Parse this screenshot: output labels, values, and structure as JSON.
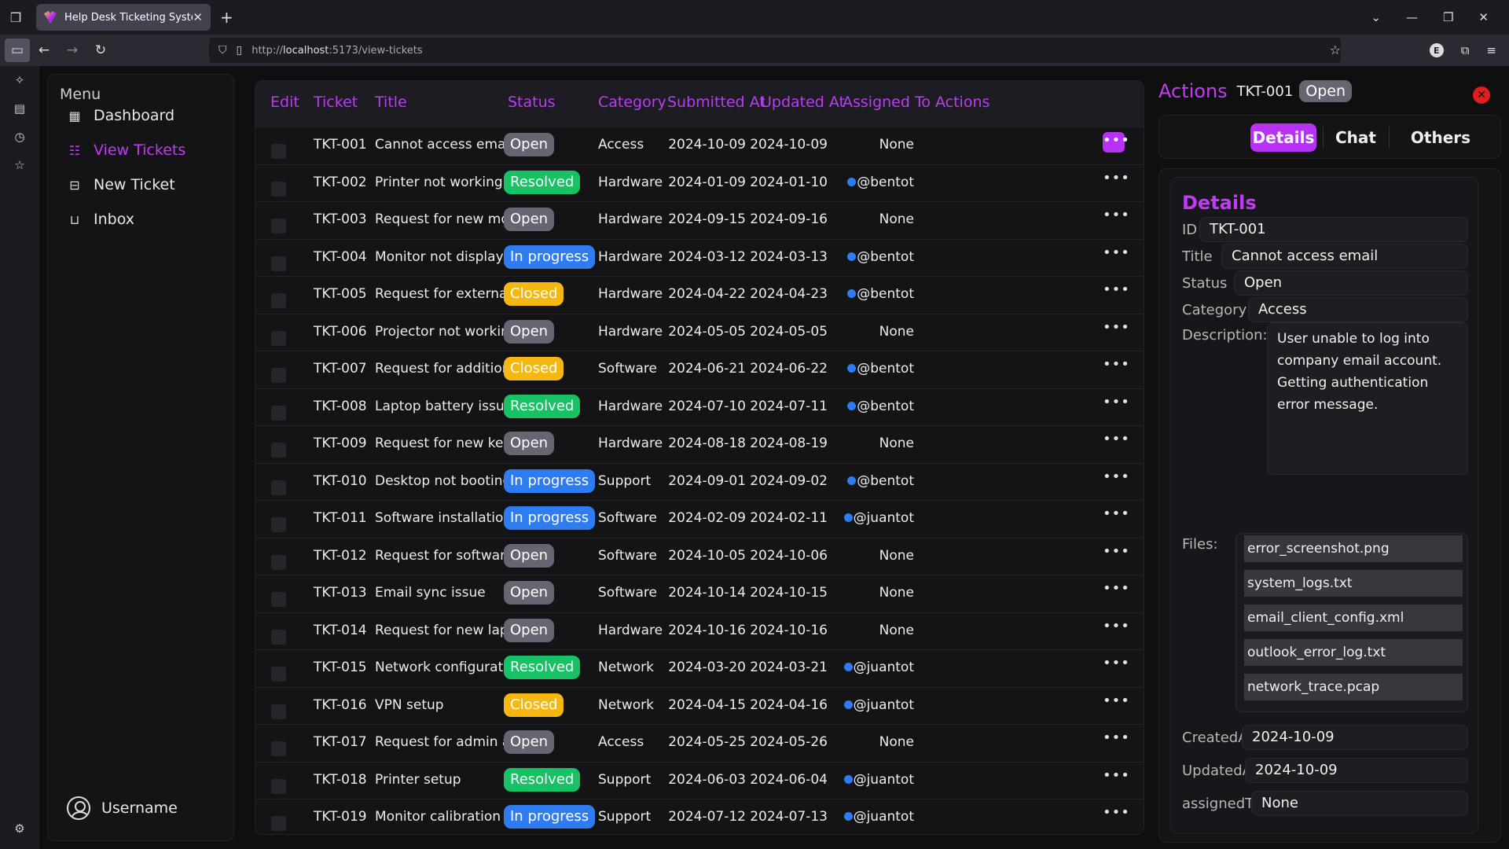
{
  "browser": {
    "tab_title": "Help Desk Ticketing System",
    "url_protocol": "http://",
    "url_host": "localhost",
    "url_path": ":5173/view-tickets",
    "ext_badge": "E"
  },
  "menu": {
    "title": "Menu",
    "items": [
      {
        "label": "Dashboard",
        "icon": "grid-icon"
      },
      {
        "label": "View Tickets",
        "icon": "list-icon"
      },
      {
        "label": "New Ticket",
        "icon": "ticket-icon"
      },
      {
        "label": "Inbox",
        "icon": "inbox-icon"
      }
    ],
    "user": "Username"
  },
  "table": {
    "headers": [
      "Edit",
      "Ticket",
      "Title",
      "Status",
      "Category",
      "Submitted At",
      "Updated At",
      "Assigned To",
      "Actions"
    ],
    "rows": [
      {
        "id": "TKT-001",
        "title": "Cannot access email",
        "status": "Open",
        "category": "Access",
        "submitted": "2024-10-09",
        "updated": "2024-10-09",
        "assigned": "None"
      },
      {
        "id": "TKT-002",
        "title": "Printer not working",
        "status": "Resolved",
        "category": "Hardware",
        "submitted": "2024-01-09",
        "updated": "2024-01-10",
        "assigned": "@bentot"
      },
      {
        "id": "TKT-003",
        "title": "Request for new mo...",
        "status": "Open",
        "category": "Hardware",
        "submitted": "2024-09-15",
        "updated": "2024-09-16",
        "assigned": "None"
      },
      {
        "id": "TKT-004",
        "title": "Monitor not displayi...",
        "status": "In progress",
        "category": "Hardware",
        "submitted": "2024-03-12",
        "updated": "2024-03-13",
        "assigned": "@bentot"
      },
      {
        "id": "TKT-005",
        "title": "Request for external...",
        "status": "Closed",
        "category": "Hardware",
        "submitted": "2024-04-22",
        "updated": "2024-04-23",
        "assigned": "@bentot"
      },
      {
        "id": "TKT-006",
        "title": "Projector not working",
        "status": "Open",
        "category": "Hardware",
        "submitted": "2024-05-05",
        "updated": "2024-05-05",
        "assigned": "None"
      },
      {
        "id": "TKT-007",
        "title": "Request for addition...",
        "status": "Closed",
        "category": "Software",
        "submitted": "2024-06-21",
        "updated": "2024-06-22",
        "assigned": "@bentot"
      },
      {
        "id": "TKT-008",
        "title": "Laptop battery issue",
        "status": "Resolved",
        "category": "Hardware",
        "submitted": "2024-07-10",
        "updated": "2024-07-11",
        "assigned": "@bentot"
      },
      {
        "id": "TKT-009",
        "title": "Request for new key...",
        "status": "Open",
        "category": "Hardware",
        "submitted": "2024-08-18",
        "updated": "2024-08-19",
        "assigned": "None"
      },
      {
        "id": "TKT-010",
        "title": "Desktop not booting",
        "status": "In progress",
        "category": "Support",
        "submitted": "2024-09-01",
        "updated": "2024-09-02",
        "assigned": "@bentot"
      },
      {
        "id": "TKT-011",
        "title": "Software installatio...",
        "status": "In progress",
        "category": "Software",
        "submitted": "2024-02-09",
        "updated": "2024-02-11",
        "assigned": "@juantot"
      },
      {
        "id": "TKT-012",
        "title": "Request for softwar...",
        "status": "Open",
        "category": "Software",
        "submitted": "2024-10-05",
        "updated": "2024-10-06",
        "assigned": "None"
      },
      {
        "id": "TKT-013",
        "title": "Email sync issue",
        "status": "Open",
        "category": "Software",
        "submitted": "2024-10-14",
        "updated": "2024-10-15",
        "assigned": "None"
      },
      {
        "id": "TKT-014",
        "title": "Request for new lap...",
        "status": "Open",
        "category": "Hardware",
        "submitted": "2024-10-16",
        "updated": "2024-10-16",
        "assigned": "None"
      },
      {
        "id": "TKT-015",
        "title": "Network configurati...",
        "status": "Resolved",
        "category": "Network",
        "submitted": "2024-03-20",
        "updated": "2024-03-21",
        "assigned": "@juantot"
      },
      {
        "id": "TKT-016",
        "title": "VPN setup",
        "status": "Closed",
        "category": "Network",
        "submitted": "2024-04-15",
        "updated": "2024-04-16",
        "assigned": "@juantot"
      },
      {
        "id": "TKT-017",
        "title": "Request for admin a...",
        "status": "Open",
        "category": "Access",
        "submitted": "2024-05-25",
        "updated": "2024-05-26",
        "assigned": "None"
      },
      {
        "id": "TKT-018",
        "title": "Printer setup",
        "status": "Resolved",
        "category": "Support",
        "submitted": "2024-06-03",
        "updated": "2024-06-04",
        "assigned": "@juantot"
      },
      {
        "id": "TKT-019",
        "title": "Monitor calibration",
        "status": "In progress",
        "category": "Support",
        "submitted": "2024-07-12",
        "updated": "2024-07-13",
        "assigned": "@juantot"
      }
    ],
    "actions_glyph": "•••"
  },
  "panel": {
    "title": "Actions",
    "ticket_id": "TKT-001",
    "status": "Open",
    "tabs": [
      "Details",
      "Chat",
      "Others"
    ],
    "details": {
      "heading": "Details",
      "id_label": "ID",
      "id": "TKT-001",
      "title_label": "Title",
      "title": "Cannot access email",
      "status_label": "Status",
      "status": "Open",
      "category_label": "Category",
      "category": "Access",
      "description_label": "Description:",
      "description": "User unable to log into company email account. Getting authentication error message.",
      "files_label": "Files:",
      "files": [
        "error_screenshot.png",
        "system_logs.txt",
        "email_client_config.xml",
        "outlook_error_log.txt",
        "network_trace.pcap"
      ],
      "created_label": "CreatedAt",
      "created": "2024-10-09",
      "updated_label": "UpdatedAt",
      "updated": "2024-10-09",
      "assigned_label": "assignedTo:",
      "assigned": "None"
    }
  },
  "colors": {
    "accent": "#b832f5",
    "open": "#656672",
    "resolved": "#18c164",
    "in_progress": "#2f7cf0",
    "closed": "#f5b712"
  }
}
